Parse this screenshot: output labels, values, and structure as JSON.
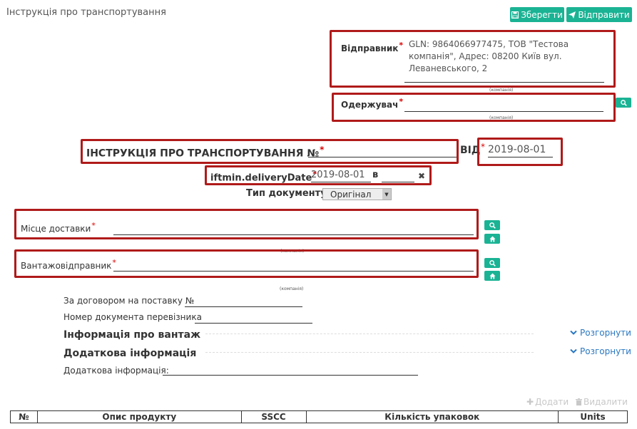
{
  "header": {
    "title": "Інструкція про транспортування",
    "save_label": "Зберегти",
    "send_label": "Відправити"
  },
  "sender": {
    "label": "Відправник",
    "value": "GLN: 9864066977475, ТОВ \"Тестова компанія\", Адрес: 08200 Київ вул. Леваневського, 2",
    "caption": "(компанія)"
  },
  "receiver": {
    "label": "Одержувач",
    "value": "",
    "caption": "(компанія)"
  },
  "doc_heading": {
    "label": "ІНСТРУКЦІЯ ПРО ТРАНСПОРТУВАННЯ №",
    "number": "",
    "from_label": "ВІД",
    "date": "2019-08-01"
  },
  "delivery": {
    "label": "iftmin.deliveryDate",
    "date": "2019-08-01",
    "in_label": "в",
    "time": "",
    "clear_icon": "close-icon"
  },
  "doc_type": {
    "label": "Тип документу",
    "selected": "Оригінал"
  },
  "delivery_place": {
    "label": "Місце доставки",
    "value": "",
    "caption": "(компанія)"
  },
  "shipper": {
    "label": "Вантажовідправник",
    "value": "",
    "caption": "(компанія)"
  },
  "contract": {
    "label": "За договором на поставку №",
    "value": ""
  },
  "carrier_doc": {
    "label": "Номер документа перевізника",
    "value": ""
  },
  "cargo_info": {
    "title": "Інформація про вантаж",
    "expand_label": "Розгорнути"
  },
  "extra_info": {
    "title": "Додаткова інформація",
    "expand_label": "Розгорнути",
    "field_label": "Додаткова інформація:",
    "field_value": ""
  },
  "table_actions": {
    "add_label": "Додати",
    "delete_label": "Видалити"
  },
  "table": {
    "columns": [
      "№",
      "Опис продукту",
      "SSCC",
      "Кількість упаковок",
      "Units"
    ]
  },
  "colors": {
    "accent": "#1ab394",
    "highlight_border": "#b01a1a",
    "link": "#2a78c2"
  }
}
